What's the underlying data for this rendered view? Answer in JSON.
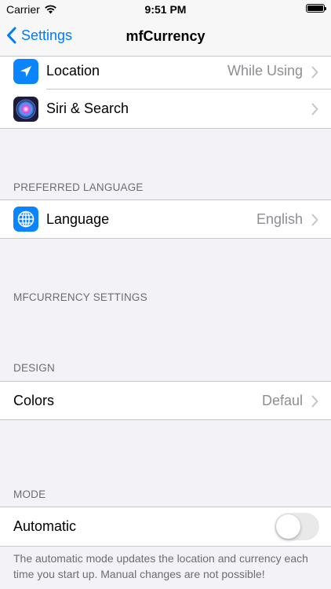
{
  "status_bar": {
    "carrier": "Carrier",
    "time": "9:51 PM"
  },
  "nav": {
    "back_label": "Settings",
    "title": "mfCurrency"
  },
  "rows_top": [
    {
      "label": "Location",
      "detail": "While Using",
      "icon": "location-arrow-icon",
      "color": "#0a84ff"
    },
    {
      "label": "Siri & Search",
      "detail": "",
      "icon": "siri-icon",
      "color": "#1c1c3a"
    }
  ],
  "sections": {
    "preferred_language": {
      "header": "PREFERRED LANGUAGE",
      "row": {
        "label": "Language",
        "detail": "English",
        "icon": "globe-icon",
        "color": "#0a84ff"
      }
    },
    "mfcurrency_settings": {
      "header": "MFCURRENCY SETTINGS"
    },
    "design": {
      "header": "DESIGN",
      "row": {
        "label": "Colors",
        "detail": "Defaul"
      }
    },
    "mode": {
      "header": "MODE",
      "row": {
        "label": "Automatic",
        "toggle_on": false
      },
      "footer": "The automatic mode updates the location and currency each time you start up. Manual changes are not possible!"
    }
  },
  "colors": {
    "accent": "#007aff",
    "background": "#f2f2f7",
    "separator": "#c8c7cc",
    "secondary_text": "#8e8e93"
  }
}
